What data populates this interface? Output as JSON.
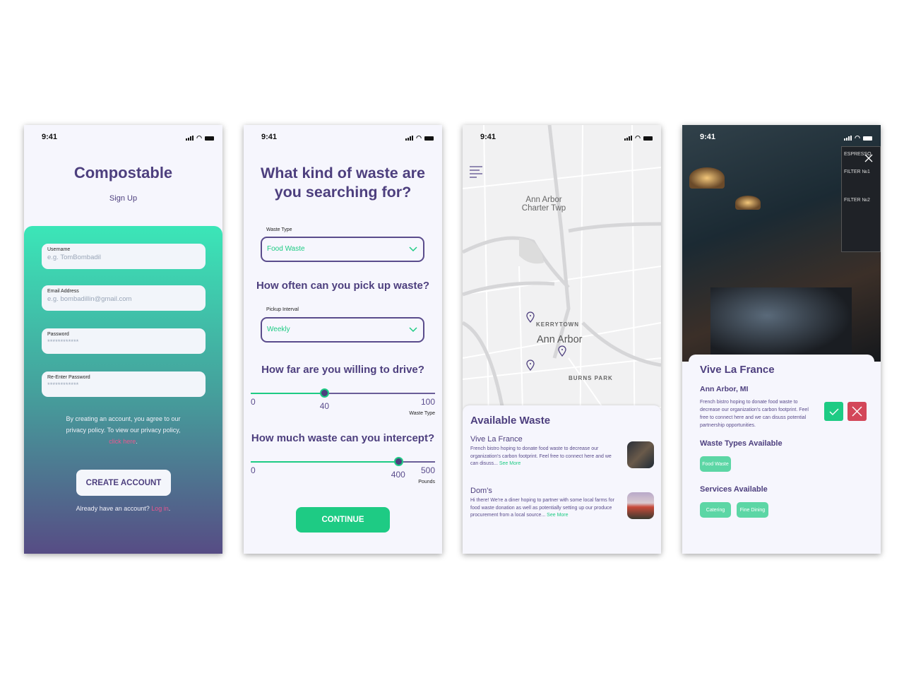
{
  "status_time": "9:41",
  "colors": {
    "purple": "#4d3f7e",
    "green": "#1ecb84",
    "pink": "#e8578f",
    "red": "#d34759",
    "background": "#f6f6fd"
  },
  "signup": {
    "title": "Compostable",
    "subtitle": "Sign Up",
    "fields": [
      {
        "label": "Username",
        "placeholder": "e.g. TomBombadil"
      },
      {
        "label": "Email Address",
        "placeholder": "e.g. bombadillin@gmail.com"
      },
      {
        "label": "Password",
        "placeholder": "************"
      },
      {
        "label": "Re-Enter Password",
        "placeholder": "************"
      }
    ],
    "legal_text": "By creating an account, you agree to our privacy policy. To view our privacy policy,",
    "legal_link": "click here",
    "period": ".",
    "create_button": "CREATE ACCOUNT",
    "login_prompt": "Already have an account?",
    "login_link": "Log in"
  },
  "preferences": {
    "title_line1": "What kind of waste are",
    "title_line2": "you searching for?",
    "waste_type_label": "Waste Type",
    "waste_type_value": "Food Waste",
    "pickup_question": "How often can you pick up waste?",
    "pickup_label": "Pickup Interval",
    "pickup_value": "Weekly",
    "drive_question": "How far are you willing to drive?",
    "drive_slider": {
      "min": "0",
      "max": "100",
      "value": "40",
      "fraction": 0.4,
      "unit": "Waste Type"
    },
    "intercept_question": "How much waste can you intercept?",
    "intercept_slider": {
      "min": "0",
      "max": "500",
      "value": "400",
      "fraction": 0.8,
      "unit": "Pounds"
    },
    "continue_button": "CONTINUE"
  },
  "map": {
    "labels": {
      "township_1": "Ann Arbor",
      "township_2": "Charter Twp",
      "kerrytown": "KERRYTOWN",
      "city": "Ann Arbor",
      "burns_park": "BURNS PARK"
    },
    "panel_title": "Available Waste",
    "listings": [
      {
        "name": "Vive La France",
        "description": "French bistro hoping to donate food waste to decrease our organization's carbon footprint. Feel free to connect here and we can disuss...",
        "link": "See More"
      },
      {
        "name": "Dom's",
        "description": "Hi there! We're a diner hoping to partner with some local farms for food waste donation as well as potentially setting up our produce procurement from a local source...",
        "link": "See More"
      }
    ]
  },
  "detail": {
    "name": "Vive La France",
    "location": "Ann Arbor, MI",
    "description": "French bistro hoping to donate food waste to decrease our organization's carbon footprint. Feel free to connect here and we can disuss potential partnership opportunities.",
    "waste_heading": "Waste Types Available",
    "waste_types": [
      "Food Waste"
    ],
    "services_heading": "Services Available",
    "services": [
      "Catering",
      "Fine Dining"
    ],
    "photo_signs": [
      "ESPRESSO",
      "FILTER №1",
      "FILTER №2"
    ]
  }
}
